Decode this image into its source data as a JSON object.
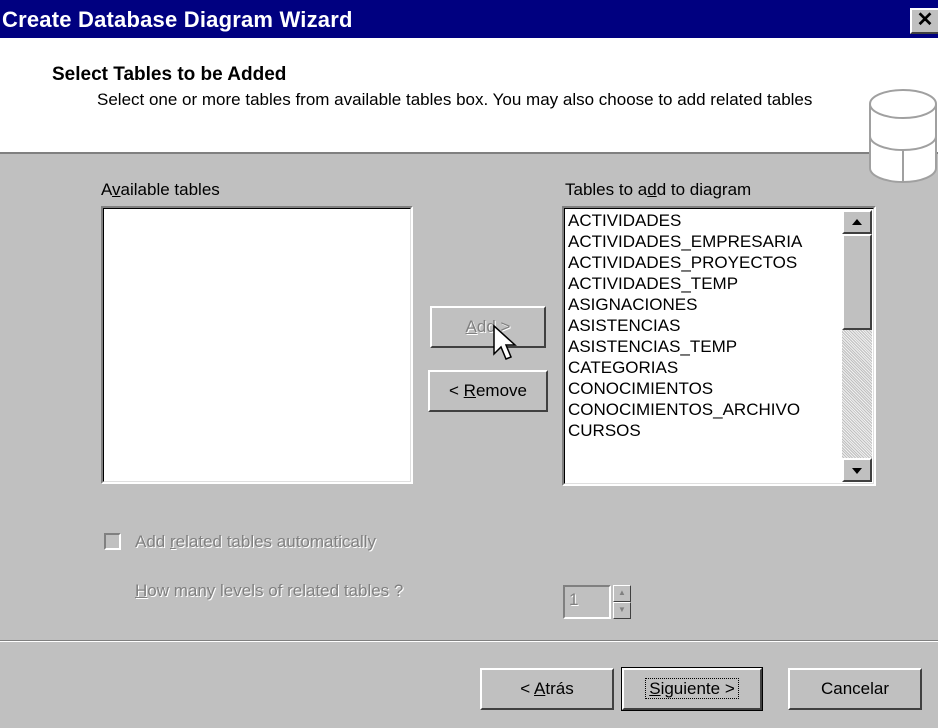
{
  "window": {
    "title": "Create Database Diagram Wizard",
    "close_glyph": "✕"
  },
  "header": {
    "title": "Select Tables to be Added",
    "description": "Select one or more tables from available tables box. You may also choose to add related tables",
    "icon": "database-cylinder-icon"
  },
  "available": {
    "label_pre": "A",
    "label_ul": "v",
    "label_post": "ailable tables",
    "items": []
  },
  "to_add": {
    "label_pre": "Tables to a",
    "label_ul": "d",
    "label_post": "d to diagram",
    "items": [
      "ACTIVIDADES",
      "ACTIVIDADES_EMPRESARIA",
      "ACTIVIDADES_PROYECTOS",
      "ACTIVIDADES_TEMP",
      "ASIGNACIONES",
      "ASISTENCIAS",
      "ASISTENCIAS_TEMP",
      "CATEGORIAS",
      "CONOCIMIENTOS",
      "CONOCIMIENTOS_ARCHIVO",
      "CURSOS"
    ]
  },
  "buttons": {
    "add": {
      "ul": "A",
      "post": "dd >"
    },
    "remove": {
      "pre": "< ",
      "ul": "R",
      "post": "emove"
    },
    "back": {
      "pre": "< ",
      "ul": "A",
      "post": "trás"
    },
    "next": {
      "ul": "S",
      "post": "iguiente >"
    },
    "cancel": "Cancelar"
  },
  "options": {
    "related_pre": "Add ",
    "related_ul": "r",
    "related_post": "elated tables automatically",
    "levels_ul": "H",
    "levels_post": "ow many levels of related tables ?",
    "levels_value": "1",
    "related_checked": false
  },
  "colors": {
    "titlebar": "#000080",
    "dialog": "#c0c0c0",
    "disabled_text": "#808080"
  }
}
